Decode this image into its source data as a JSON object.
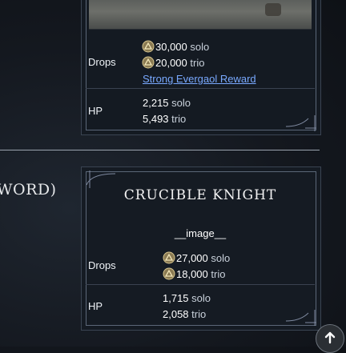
{
  "card_top": {
    "drops_label": "Drops",
    "drops": [
      {
        "value": "30,000",
        "mode": "solo"
      },
      {
        "value": "20,000",
        "mode": "trio"
      }
    ],
    "reward_link": "Strong Evergaol Reward",
    "hp_label": "HP",
    "hp": [
      {
        "value": "2,215",
        "mode": "solo"
      },
      {
        "value": "5,493",
        "mode": "trio"
      }
    ]
  },
  "left_heading": "WORD)",
  "card_bottom": {
    "title": "CRUCIBLE KNIGHT",
    "image_placeholder": "__image__",
    "drops_label": "Drops",
    "drops": [
      {
        "value": "27,000",
        "mode": "solo"
      },
      {
        "value": "18,000",
        "mode": "trio"
      }
    ],
    "hp_label": "HP",
    "hp": [
      {
        "value": "1,715",
        "mode": "solo"
      },
      {
        "value": "2,058",
        "mode": "trio"
      }
    ]
  },
  "icons": {
    "rune": "rune-icon",
    "scroll_top": "arrow-up-icon"
  },
  "colors": {
    "link": "#79a9ff",
    "card_bg": "#141a22",
    "border": "#5b6778"
  }
}
